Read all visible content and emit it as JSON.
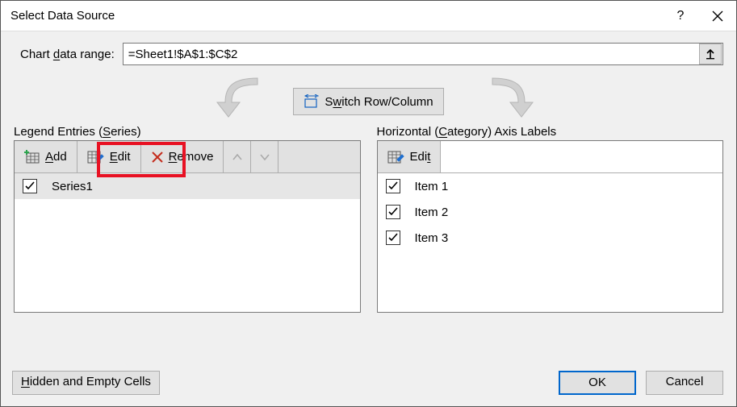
{
  "title": "Select Data Source",
  "range": {
    "label_pre": "Chart ",
    "label_u": "d",
    "label_post": "ata range:",
    "value": "=Sheet1!$A$1:$C$2"
  },
  "switch": {
    "pre": "S",
    "u": "w",
    "post": "itch Row/Column"
  },
  "legend": {
    "label_pre": "Legend Entries (",
    "label_u": "S",
    "label_post": "eries)",
    "add_u": "A",
    "add_post": "dd",
    "edit_u": "E",
    "edit_post": "dit",
    "remove_u": "R",
    "remove_post": "emove",
    "items": [
      {
        "label": "Series1",
        "checked": true
      }
    ]
  },
  "category": {
    "label_pre": "Horizontal (",
    "label_u": "C",
    "label_post": "ategory) Axis Labels",
    "edit": {
      "pre": "Edi",
      "u": "t"
    },
    "items": [
      {
        "label": "Item 1",
        "checked": true
      },
      {
        "label": "Item 2",
        "checked": true
      },
      {
        "label": "Item 3",
        "checked": true
      }
    ]
  },
  "footer": {
    "hidden_u": "H",
    "hidden_post": "idden and Empty Cells",
    "ok": "OK",
    "cancel": "Cancel"
  }
}
